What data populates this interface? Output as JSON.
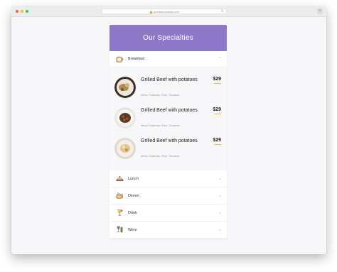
{
  "browser": {
    "url": "preview.colorlib.com",
    "reload_icon": "reload-icon",
    "new_tab_icon": "plus-icon",
    "new_tab_label": "+",
    "reload_glyph": "↻",
    "lock_glyph": "🔒"
  },
  "menu": {
    "title": "Our Specialties",
    "active_category": {
      "label": "Breakfast",
      "icon": "breakfast-icon",
      "chevron": "⌃"
    },
    "items": [
      {
        "name": "Grilled Beef with potatoes",
        "description": "Meat, Potatoes, Rice, Tomatoe",
        "price": "$29"
      },
      {
        "name": "Grilled Beef with potatoes",
        "description": "Meat, Potatoes, Rice, Tomatoe",
        "price": "$29"
      },
      {
        "name": "Grilled Beef with potatoes",
        "description": "Meat, Potatoes, Rice, Tomatoe",
        "price": "$29"
      }
    ],
    "other_categories": [
      {
        "label": "Lunch",
        "icon": "lunch-icon",
        "chevron": "⌄"
      },
      {
        "label": "Dinner",
        "icon": "dinner-icon",
        "chevron": "⌄"
      },
      {
        "label": "Drink",
        "icon": "drink-icon",
        "chevron": "⌄"
      },
      {
        "label": "Wine",
        "icon": "wine-icon",
        "chevron": "⌄"
      }
    ]
  },
  "colors": {
    "header_bg": "#8c77c9",
    "price_underline": "#f2b53b"
  }
}
